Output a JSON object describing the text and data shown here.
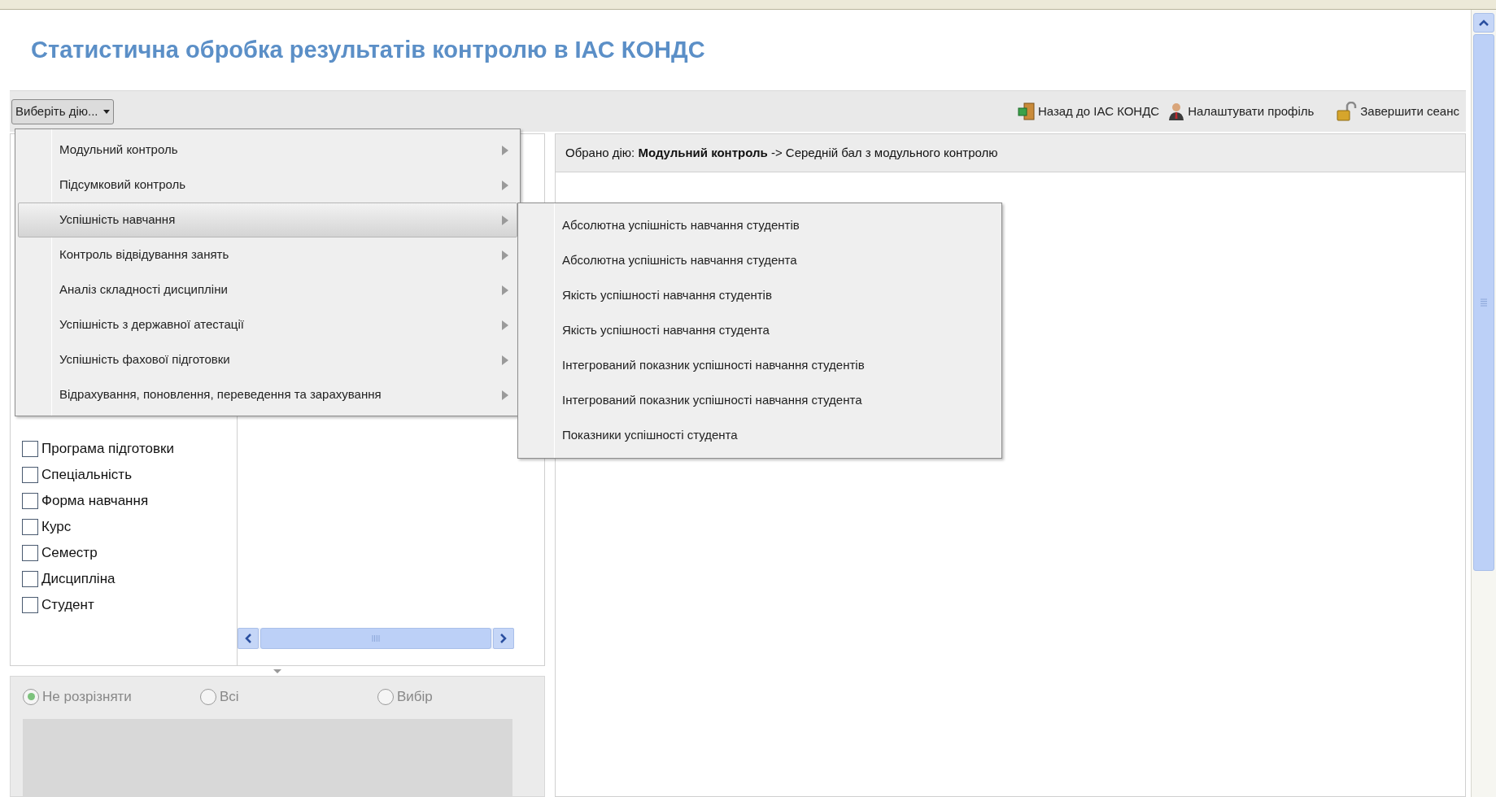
{
  "title": "Статистична обробка результатів контролю в ІАС КОНДС",
  "action_button": {
    "label": "Виберіть дію...",
    "expanded": true
  },
  "toolbar_links": [
    "Назад до ІАС КОНДС",
    "Налаштувати профіль",
    "Завершити сеанс"
  ],
  "selected_action": "Обрано дію: **Модульний контроль** -> Середній бал з модульного контролю",
  "menu": {
    "items": [
      {
        "label": "Модульний контроль",
        "selected": false
      },
      {
        "label": "Підсумковий контроль",
        "selected": false
      },
      {
        "label": "Успішність навчання",
        "selected": true
      },
      {
        "label": "Контроль відвідування занять",
        "selected": false
      },
      {
        "label": "Аналіз складності дисципліни",
        "selected": false
      },
      {
        "label": "Успішність з державної атестації",
        "selected": false
      },
      {
        "label": "Успішність фахової підготовки",
        "selected": false
      },
      {
        "label": "Відрахування, поновлення, переведення та зарахування",
        "selected": false
      }
    ],
    "submenu": [
      "Абсолютна успішність навчання студентів",
      "Абсолютна успішність навчання студента",
      "Якість успішності навчання студентів",
      "Якість успішності навчання студента",
      "Інтегрований показник успішності навчання студентів",
      "Інтегрований показник успішності навчання студента",
      "Показники успішності студента"
    ]
  },
  "filters": [
    {
      "label": "Програма підготовки",
      "checked": false
    },
    {
      "label": "Спеціальність",
      "checked": false
    },
    {
      "label": "Форма навчання",
      "checked": false
    },
    {
      "label": "Курс",
      "checked": false
    },
    {
      "label": "Семестр",
      "checked": false
    },
    {
      "label": "Дисципліна",
      "checked": false
    },
    {
      "label": "Студент",
      "checked": false
    }
  ],
  "grouping": [
    {
      "label": "Не розрізняти",
      "selected": true
    },
    {
      "label": "Всі",
      "selected": false
    },
    {
      "label": "Вибір",
      "selected": false
    }
  ]
}
